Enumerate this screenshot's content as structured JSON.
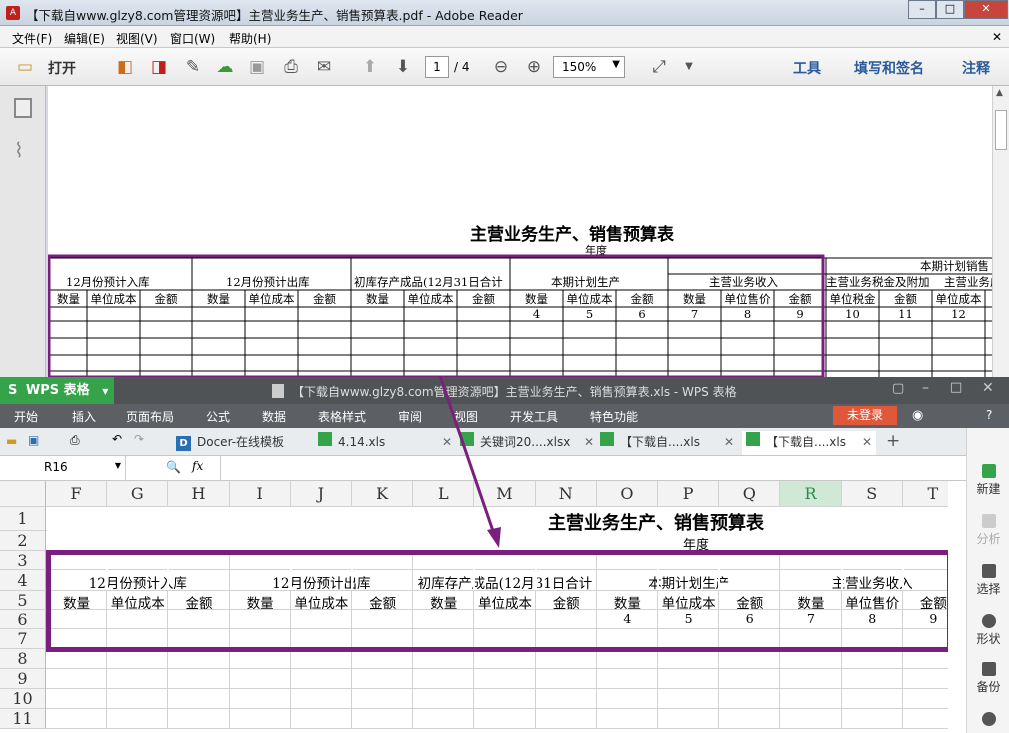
{
  "pdf": {
    "window_title": "【下载自www.glzy8.com管理资源吧】主营业务生产、销售预算表.pdf - Adobe Reader",
    "menu": [
      "文件(F)",
      "编辑(E)",
      "视图(V)",
      "窗口(W)",
      "帮助(H)"
    ],
    "toolbar": {
      "open": "打开",
      "page_current": "1",
      "page_total": "/ 4",
      "zoom": "150%",
      "tools": "工具",
      "fill_sign": "填写和签名",
      "comment": "注释"
    },
    "doc": {
      "title": "主营业务生产、销售预算表",
      "subtitle": "年度",
      "groups": [
        "12月份预计入库",
        "12月份预计出库",
        "初库存产成品(12月31日合计",
        "本期计划生产",
        "主营业务收入",
        "本期计划销售"
      ],
      "sub_headers": [
        "数量",
        "单位成本",
        "金额",
        "数量",
        "单位成本",
        "金额",
        "数量",
        "单位成本",
        "金额",
        "数量",
        "单位成本",
        "金额",
        "数量",
        "单位售价",
        "金额",
        "主营业务税金及附加",
        "金额",
        "主营业务成本"
      ],
      "tax_label": "单位税金",
      "cost_unit": "单位成本",
      "numbers": [
        "4",
        "5",
        "6",
        "7",
        "8",
        "9",
        "10",
        "11",
        "12"
      ]
    }
  },
  "wps": {
    "app_name": "WPS 表格",
    "window_title": "【下载自www.glzy8.com管理资源吧】主营业务生产、销售预算表.xls - WPS 表格",
    "ribbon_tabs": [
      "开始",
      "插入",
      "页面布局",
      "公式",
      "数据",
      "表格样式",
      "审阅",
      "视图",
      "开发工具",
      "特色功能"
    ],
    "login": "未登录",
    "doc_tabs": [
      "Docer-在线模板",
      "4.14.xls",
      "关键词20....xlsx",
      "【下载自....xls",
      "【下载自....xls"
    ],
    "name_box": "R16",
    "fx": "fx",
    "columns": [
      "F",
      "G",
      "H",
      "I",
      "J",
      "K",
      "L",
      "M",
      "N",
      "O",
      "P",
      "Q",
      "R",
      "S",
      "T"
    ],
    "rows": [
      "1",
      "2",
      "3",
      "4",
      "5",
      "6",
      "7",
      "8",
      "9",
      "10",
      "11"
    ],
    "sheet": {
      "title": "主营业务生产、销售预算表",
      "subtitle": "年度",
      "groups": [
        "12月份预计入库",
        "12月份预计出库",
        "初库存产成品(12月31日合计",
        "本期计划生产",
        "主营业务收入"
      ],
      "sub_headers": [
        "数量",
        "单位成本",
        "金额",
        "数量",
        "单位成本",
        "金额",
        "数量",
        "单位成本",
        "金额",
        "数量",
        "单位成本",
        "金额",
        "数量",
        "单位售价",
        "金额"
      ],
      "numbers": [
        "4",
        "5",
        "6",
        "7",
        "8",
        "9"
      ]
    },
    "right_panel": [
      "新建",
      "分析",
      "选择",
      "形状",
      "备份"
    ]
  },
  "colors": {
    "highlight": "#7b1f7f",
    "wps_title": "#505356",
    "login": "#e0583a",
    "selected_col": "#2f8a4b"
  }
}
